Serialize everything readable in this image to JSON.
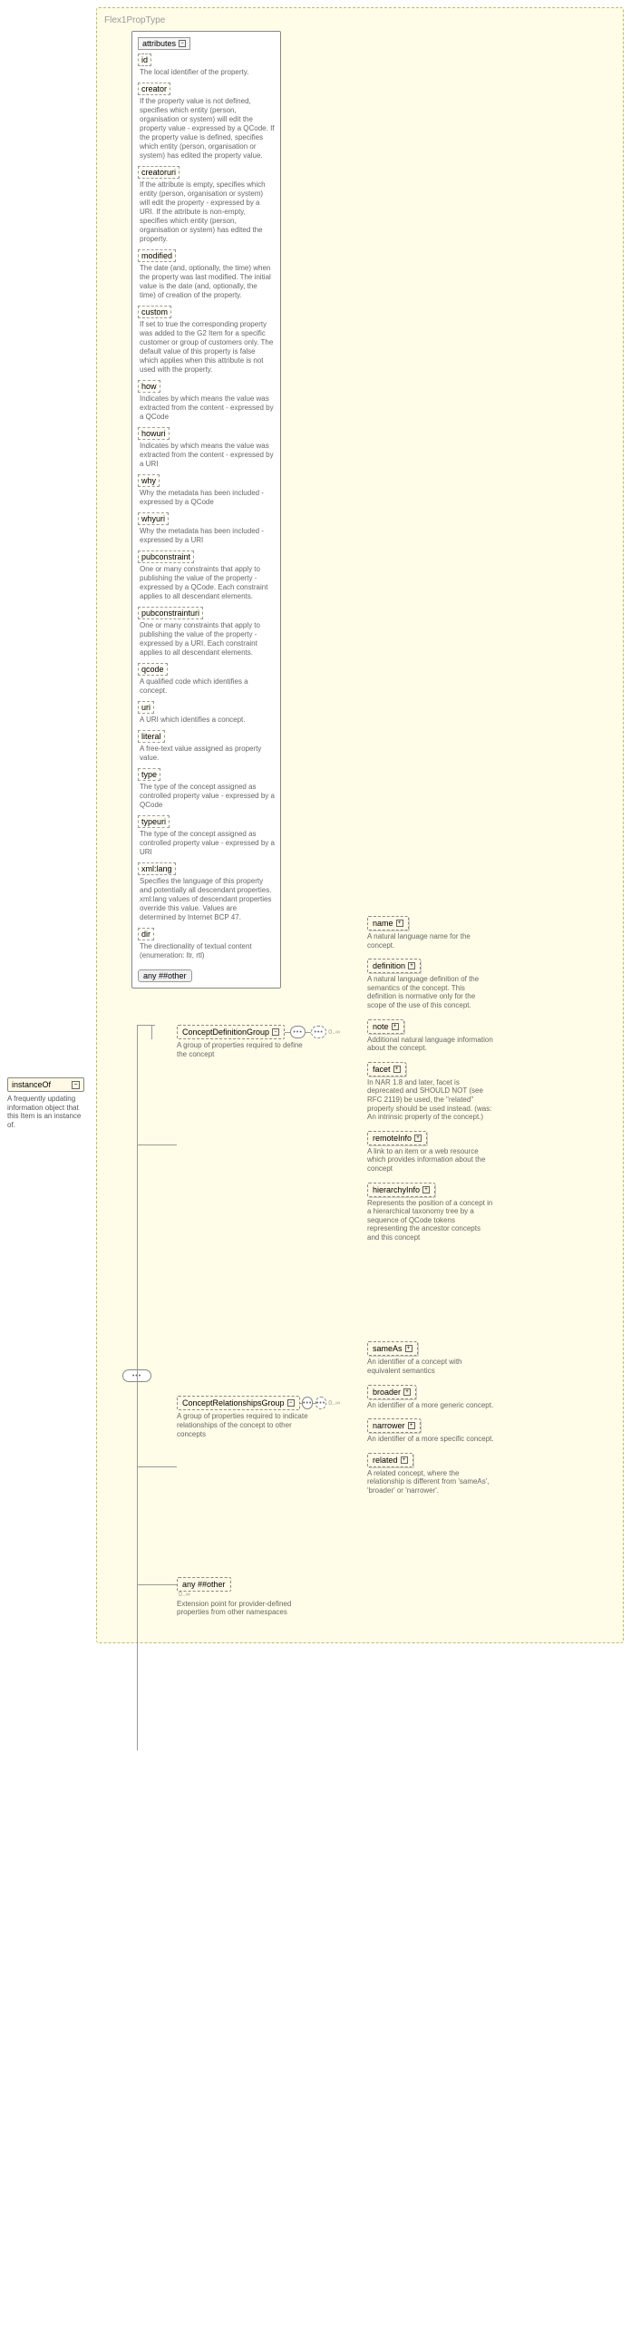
{
  "type_title": "Flex1PropType",
  "root": {
    "label": "instanceOf",
    "desc": "A frequently updating information object that this Item is an instance of."
  },
  "attrs_header": "attributes",
  "attributes": [
    {
      "name": "id",
      "desc": "The local identifier of the property."
    },
    {
      "name": "creator",
      "desc": "If the property value is not defined, specifies which entity (person, organisation or system) will edit the property value - expressed by a QCode. If the property value is defined, specifies which entity (person, organisation or system) has edited the property value."
    },
    {
      "name": "creatoruri",
      "desc": "If the attribute is empty, specifies which entity (person, organisation or system) will edit the property - expressed by a URI. If the attribute is non-empty, specifies which entity (person, organisation or system) has edited the property."
    },
    {
      "name": "modified",
      "desc": "The date (and, optionally, the time) when the property was last modified. The initial value is the date (and, optionally, the time) of creation of the property."
    },
    {
      "name": "custom",
      "desc": "If set to true the corresponding property was added to the G2 Item for a specific customer or group of customers only. The default value of this property is false which applies when this attribute is not used with the property."
    },
    {
      "name": "how",
      "desc": "Indicates by which means the value was extracted from the content - expressed by a QCode"
    },
    {
      "name": "howuri",
      "desc": "Indicates by which means the value was extracted from the content - expressed by a URI"
    },
    {
      "name": "why",
      "desc": "Why the metadata has been included - expressed by a QCode"
    },
    {
      "name": "whyuri",
      "desc": "Why the metadata has been included - expressed by a URI"
    },
    {
      "name": "pubconstraint",
      "desc": "One or many constraints that apply to publishing the value of the property - expressed by a QCode. Each constraint applies to all descendant elements."
    },
    {
      "name": "pubconstrainturi",
      "desc": "One or many constraints that apply to publishing the value of the property - expressed by a URI. Each constraint applies to all descendant elements."
    },
    {
      "name": "qcode",
      "desc": "A qualified code which identifies a concept."
    },
    {
      "name": "uri",
      "desc": "A URI which identifies a concept."
    },
    {
      "name": "literal",
      "desc": "A free-text value assigned as property value."
    },
    {
      "name": "type",
      "desc": "The type of the concept assigned as controlled property value - expressed by a QCode"
    },
    {
      "name": "typeuri",
      "desc": "The type of the concept assigned as controlled property value - expressed by a URI"
    },
    {
      "name": "xml:lang",
      "desc": "Specifies the language of this property and potentially all descendant properties. xml:lang values of descendant properties override this value. Values are determined by Internet BCP 47."
    },
    {
      "name": "dir",
      "desc": "The directionality of textual content (enumeration: ltr, rtl)"
    }
  ],
  "any_other_attr": "any ##other",
  "groups": {
    "concept_def": {
      "label": "ConceptDefinitionGroup",
      "desc": "A group of properties required to define the concept"
    },
    "concept_rel": {
      "label": "ConceptRelationshipsGroup",
      "desc": "A group of properties required to indicate relationships of the concept to other concepts"
    }
  },
  "concept_def_items": [
    {
      "name": "name",
      "desc": "A natural language name for the concept."
    },
    {
      "name": "definition",
      "desc": "A natural language definition of the semantics of the concept. This definition is normative only for the scope of the use of this concept."
    },
    {
      "name": "note",
      "desc": "Additional natural language information about the concept."
    },
    {
      "name": "facet",
      "desc": "In NAR 1.8 and later, facet is deprecated and SHOULD NOT (see RFC 2119) be used, the \"related\" property should be used instead. (was: An intrinsic property of the concept.)"
    },
    {
      "name": "remoteInfo",
      "desc": "A link to an item or a web resource which provides information about the concept"
    },
    {
      "name": "hierarchyInfo",
      "desc": "Represents the position of a concept in a hierarchical taxonomy tree by a sequence of QCode tokens representing the ancestor concepts and this concept"
    }
  ],
  "concept_rel_items": [
    {
      "name": "sameAs",
      "desc": "An identifier of a concept with equivalent semantics"
    },
    {
      "name": "broader",
      "desc": "An identifier of a more generic concept."
    },
    {
      "name": "narrower",
      "desc": "An identifier of a more specific concept."
    },
    {
      "name": "related",
      "desc": "A related concept, where the relationship is different from 'sameAs', 'broader' or 'narrower'."
    }
  ],
  "any_other_elem": {
    "label": "any ##other",
    "card": "0..∞",
    "desc": "Extension point for provider-defined properties from other namespaces"
  },
  "card_0inf": "0..∞"
}
